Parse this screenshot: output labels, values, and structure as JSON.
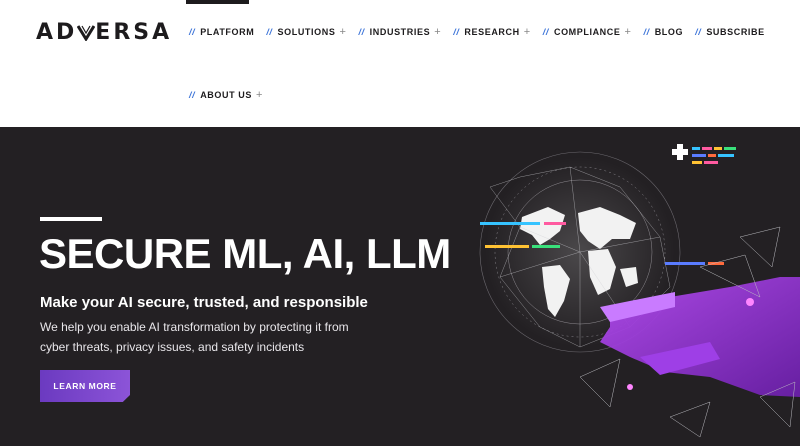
{
  "brand": {
    "name_left": "AD",
    "name_right": "ERSA",
    "logo_glyph": "V-shaped mark"
  },
  "nav": {
    "slash": "//",
    "plus": "+",
    "items": [
      {
        "label": "PLATFORM",
        "has_submenu": false
      },
      {
        "label": "SOLUTIONS",
        "has_submenu": true
      },
      {
        "label": "INDUSTRIES",
        "has_submenu": true
      },
      {
        "label": "RESEARCH",
        "has_submenu": true
      },
      {
        "label": "COMPLIANCE",
        "has_submenu": true
      },
      {
        "label": "BLOG",
        "has_submenu": false
      },
      {
        "label": "SUBSCRIBE",
        "has_submenu": false
      },
      {
        "label": "ABOUT US",
        "has_submenu": true
      }
    ]
  },
  "hero": {
    "title": "SECURE ML, AI, LLM",
    "subtitle": "Make your AI secure, trusted, and responsible",
    "description": "We help you enable AI transformation by protecting it from cyber threats, privacy issues, and safety incidents",
    "cta_label": "LEARN MORE"
  },
  "colors": {
    "hero_bg": "#232023",
    "accent_blue": "#3b73d8",
    "accent_purple": "#8c54d8",
    "text_dark": "#1d1b1d"
  },
  "icons": [
    "slash-icon",
    "plus-icon",
    "globe-illustration",
    "robot-hand-illustration"
  ]
}
